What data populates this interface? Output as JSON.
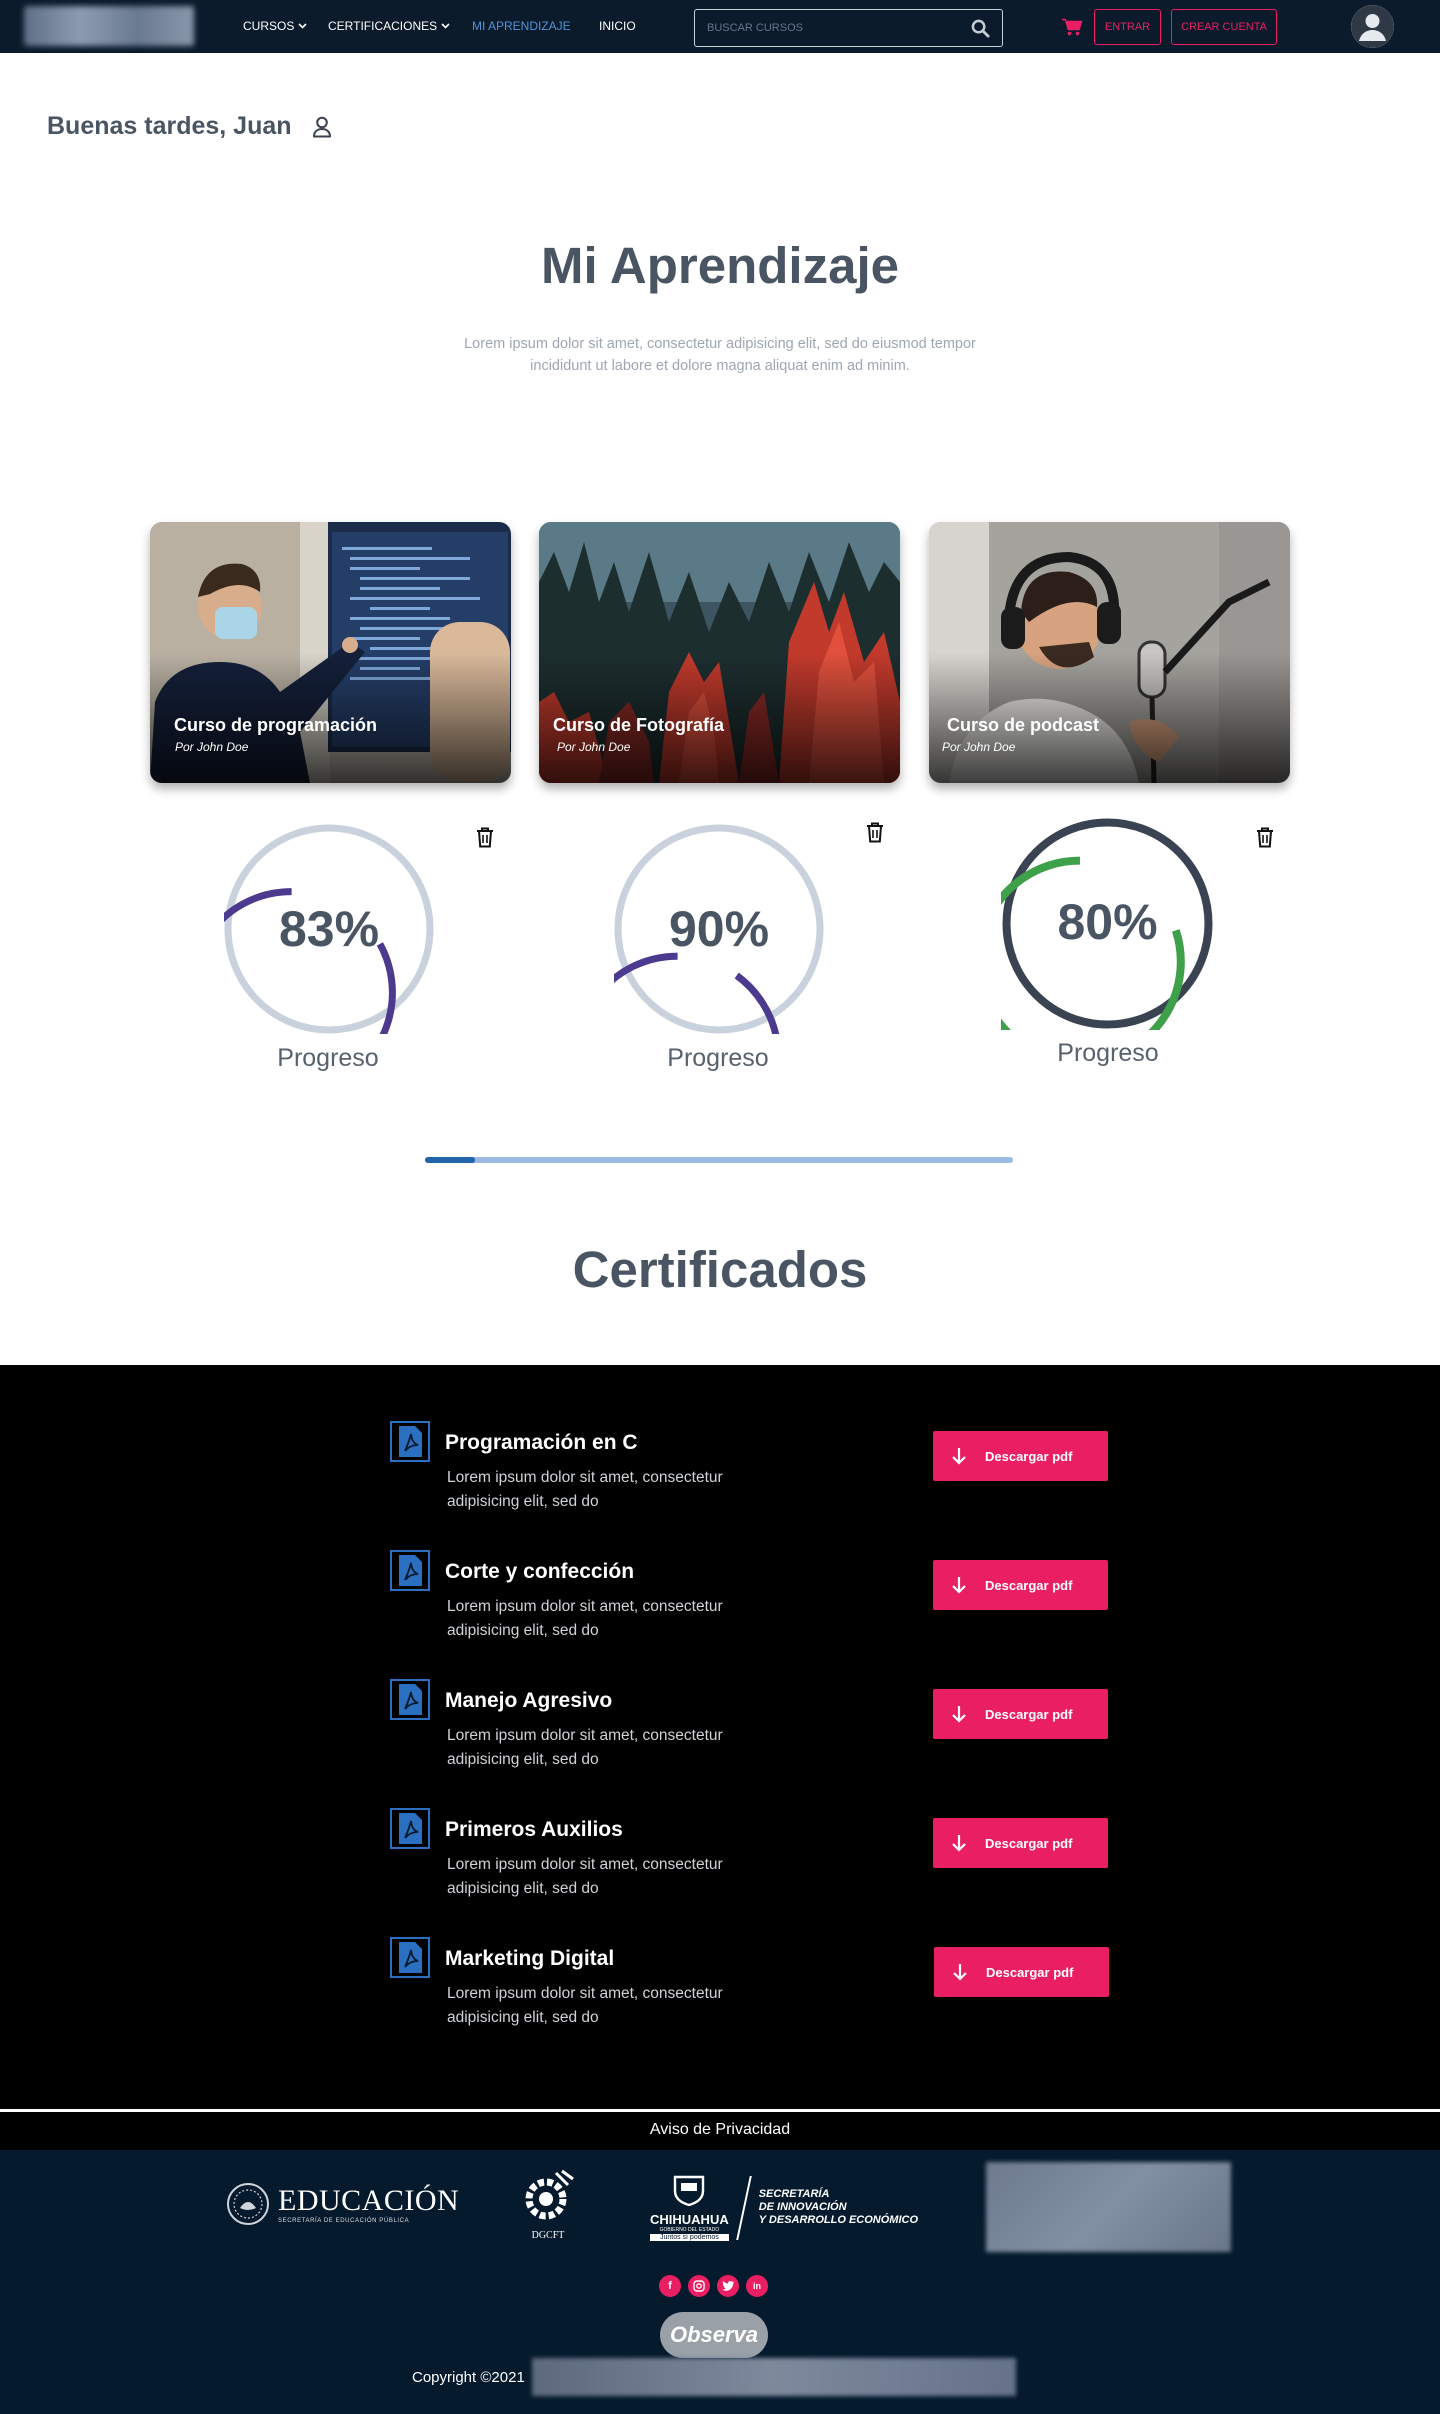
{
  "nav": {
    "items": [
      {
        "label": "CURSOS",
        "dropdown": true
      },
      {
        "label": "CERTIFICACIONES",
        "dropdown": true
      },
      {
        "label": "MI APRENDIZAJE",
        "active": true
      },
      {
        "label": "INICIO"
      }
    ],
    "search_placeholder": "BUSCAR CURSOS",
    "login_label": "ENTRAR",
    "signup_label": "CREAR CUENTA",
    "accent_color": "#e91e63",
    "active_color": "#4f94d8"
  },
  "greeting": {
    "text": "Buenas tardes, Juan",
    "icon": "user-icon"
  },
  "main": {
    "title": "Mi Aprendizaje",
    "description": "Lorem ipsum dolor sit amet, consectetur adipisicing elit, sed do eiusmod tempor incididunt ut labore et dolore magna aliquat enim ad minim."
  },
  "courses": [
    {
      "title": "Curso de programación",
      "author": "Por John Doe",
      "progress_label": "83%",
      "progress": 0.83,
      "caption": "Progreso",
      "ring_color": "#4b3a8e"
    },
    {
      "title": "Curso de Fotografía",
      "author": "Por John Doe",
      "progress_label": "90%",
      "progress": 0.9,
      "caption": "Progreso",
      "ring_color": "#4b3a8e"
    },
    {
      "title": "Curso de podcast",
      "author": "Por John Doe",
      "progress_label": "80%",
      "progress": 0.8,
      "caption": "Progreso",
      "ring_color": "#3fa04a"
    }
  ],
  "carousel": {
    "position": 0.0
  },
  "certificates": {
    "title": "Certificados",
    "button_label": "Descargar pdf",
    "items": [
      {
        "name": "Programación en C",
        "desc": "Lorem ipsum dolor sit amet, consectetur adipisicing elit, sed do"
      },
      {
        "name": "Corte y confección",
        "desc": "Lorem ipsum dolor sit amet, consectetur adipisicing elit, sed do"
      },
      {
        "name": "Manejo Agresivo",
        "desc": "Lorem ipsum dolor sit amet, consectetur adipisicing elit, sed do"
      },
      {
        "name": "Primeros Auxilios",
        "desc": "Lorem ipsum dolor sit amet, consectetur adipisicing elit, sed do"
      },
      {
        "name": "Marketing Digital",
        "desc": "Lorem ipsum dolor sit amet, consectetur adipisicing elit, sed do"
      }
    ]
  },
  "footer": {
    "privacy": "Aviso de Privacidad",
    "edu_title": "EDUCACIÓN",
    "edu_subtitle": "SECRETARÍA DE EDUCACIÓN PÚBLICA",
    "dgcft": "DGCFT",
    "chihuahua": "CHIHUAHUA",
    "chihuahua_sub": "GOBIERNO DEL ESTADO",
    "chihuahua_tag": "Juntos sí podemos",
    "secretaria": [
      "SECRETARÍA",
      "DE INNOVACIÓN",
      "Y DESARROLLO ECONÓMICO"
    ],
    "social": [
      "f",
      "ig",
      "tw",
      "in"
    ],
    "observa": "Observa",
    "copyright": "Copyright ©2021"
  }
}
